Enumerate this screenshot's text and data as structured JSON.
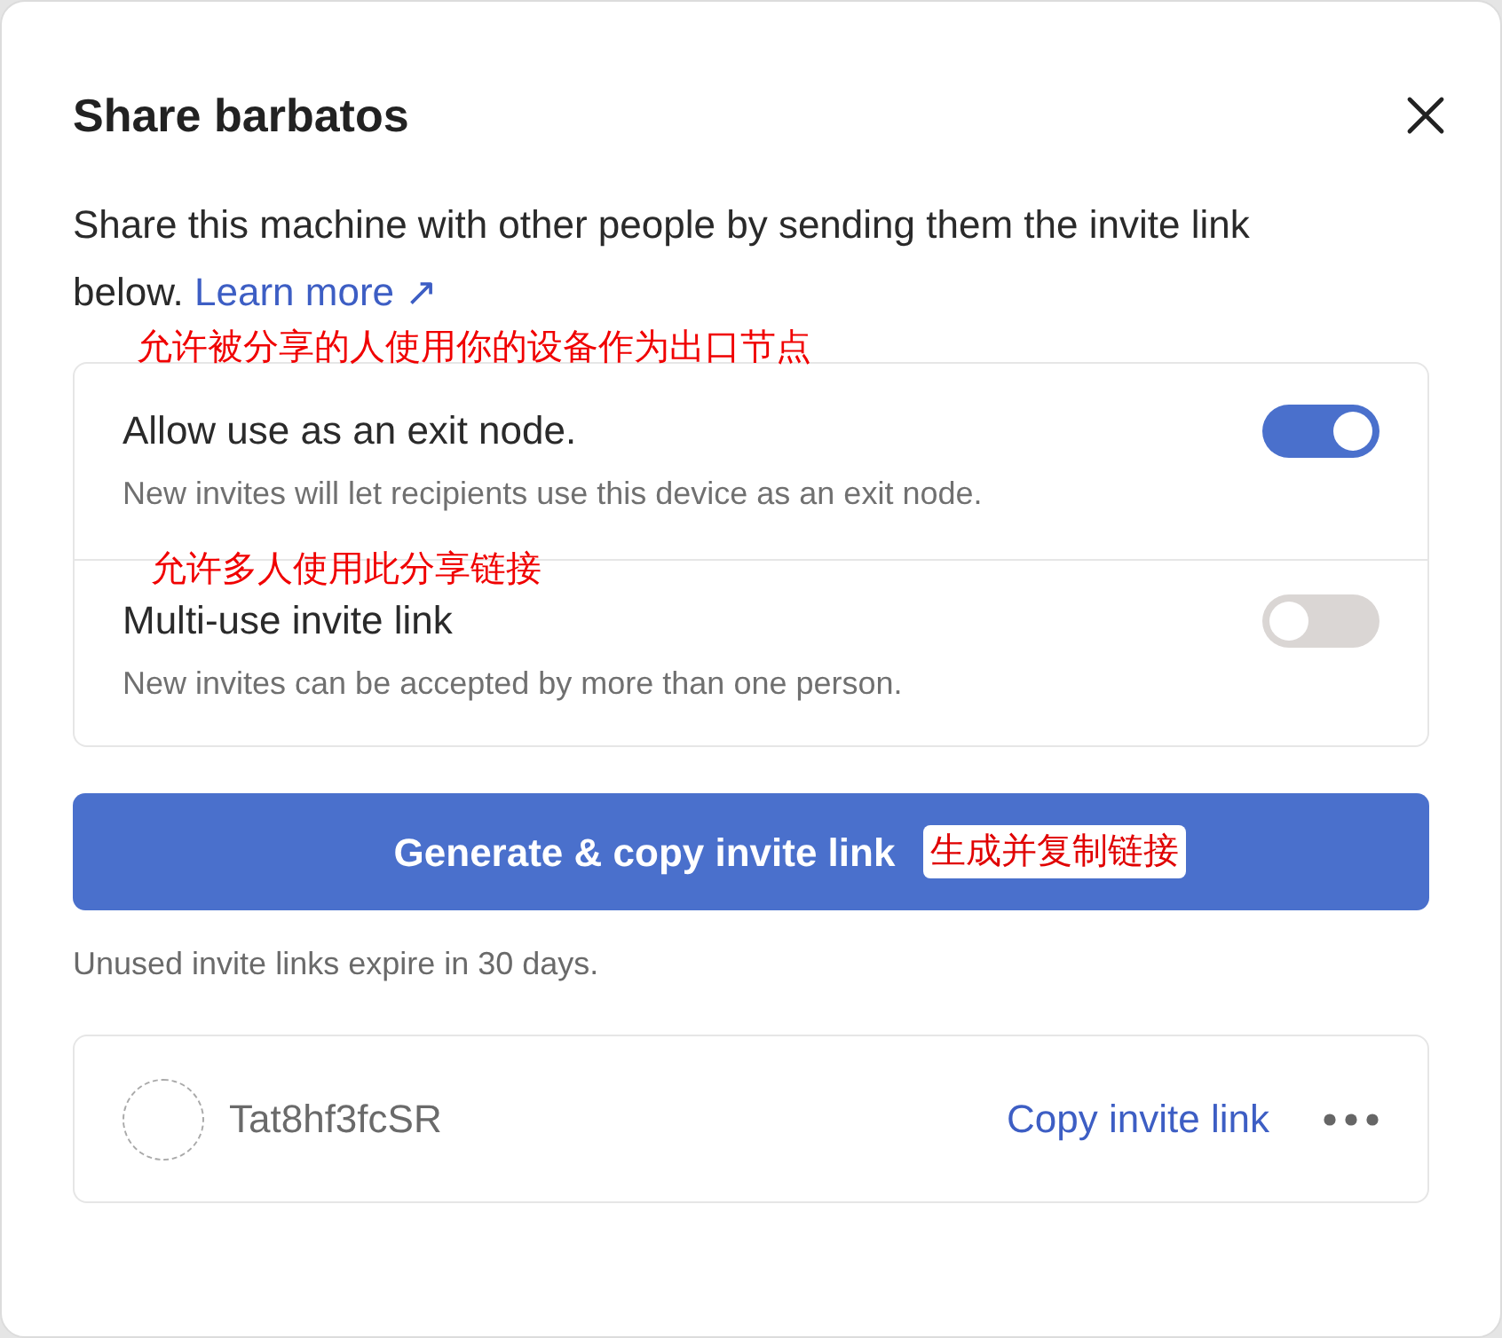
{
  "dialog": {
    "title": "Share barbatos",
    "description": "Share this machine with other people by sending them the invite link below.",
    "learn_more_link": "Learn more ↗"
  },
  "annotation_top": "允许被分享的人使用你的设备作为出口节点",
  "options": [
    {
      "label": "Allow use as an exit node.",
      "description": "New invites will let recipients use this device as an exit node.",
      "on": true
    },
    {
      "annotation": "允许多人使用此分享链接",
      "label": "Multi-use invite link",
      "description": "New invites can be accepted by more than one person.",
      "on": false
    }
  ],
  "generate_button": {
    "label": "Generate & copy invite link",
    "annotation": "生成并复制链接"
  },
  "expiry_note": "Unused invite links expire in 30 days.",
  "invites": [
    {
      "code": "Tat8hf3fcSR",
      "copy_link": "Copy invite link"
    }
  ]
}
